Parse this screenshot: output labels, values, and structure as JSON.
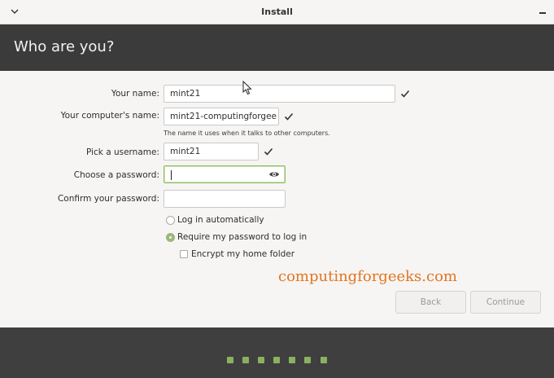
{
  "window": {
    "title": "Install"
  },
  "header": {
    "title": "Who are you?"
  },
  "form": {
    "name_label": "Your name:",
    "name_value": "mint21",
    "computer_label": "Your computer's name:",
    "computer_value": "mint21-computingforgee",
    "computer_hint": "The name it uses when it talks to other computers.",
    "username_label": "Pick a username:",
    "username_value": "mint21",
    "password_label": "Choose a password:",
    "password_value": "",
    "confirm_label": "Confirm your password:",
    "confirm_value": ""
  },
  "options": {
    "login_auto": "Log in automatically",
    "require_password": "Require my password to log in",
    "encrypt_home": "Encrypt my home folder",
    "selected": "require_password",
    "encrypt_checked": false
  },
  "watermark": "computingforgeeks.com",
  "buttons": {
    "back": "Back",
    "continue": "Continue"
  },
  "progress": {
    "steps": 7,
    "completed": 7
  },
  "colors": {
    "accent": "#8ab15f",
    "header_bg": "#3b3b3b",
    "watermark": "#e3751f"
  }
}
